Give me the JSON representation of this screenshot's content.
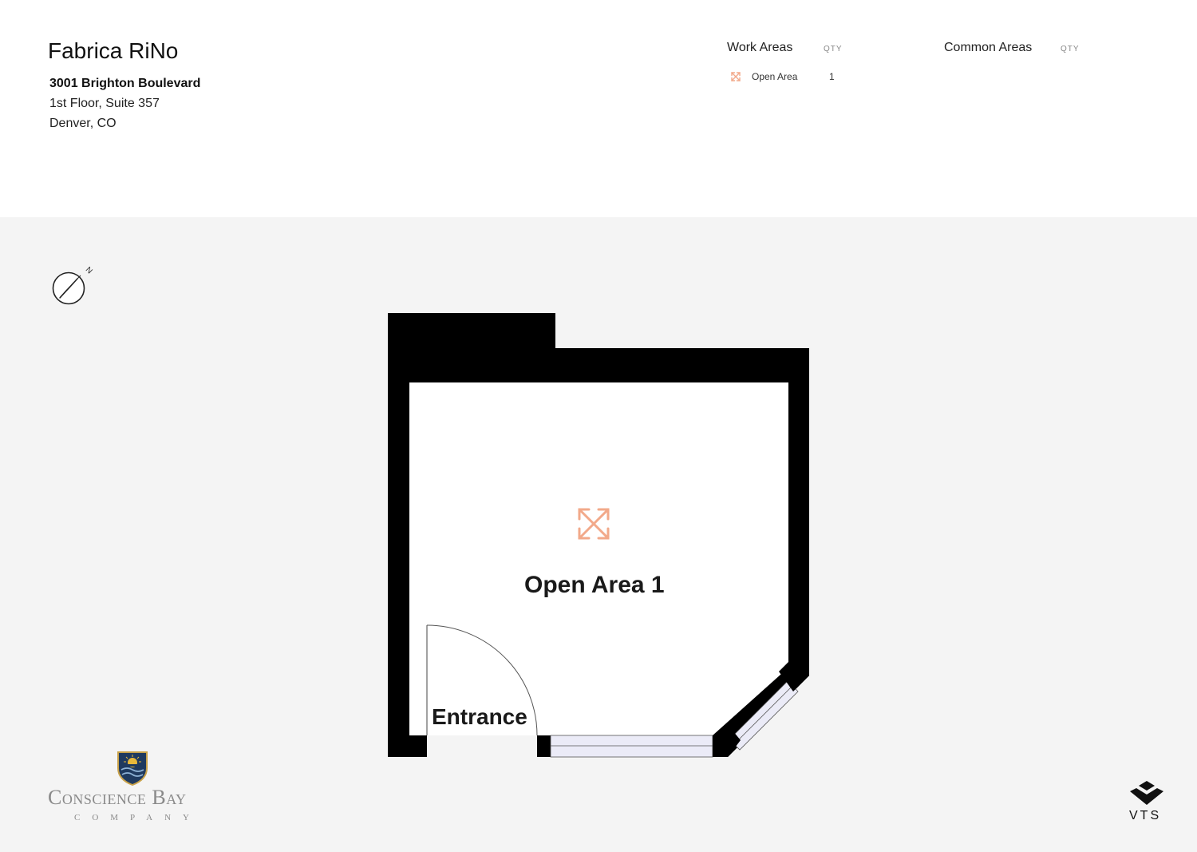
{
  "header": {
    "title": "Fabrica RiNo",
    "address_line1": "3001 Brighton Boulevard",
    "address_line2": "1st Floor, Suite 357",
    "address_line3": "Denver, CO"
  },
  "legend": {
    "work_areas_heading": "Work Areas",
    "work_areas_qty_heading": "QTY",
    "work_areas_items": [
      {
        "label": "Open Area",
        "qty": "1",
        "icon": "expand-arrows-icon"
      }
    ],
    "common_areas_heading": "Common Areas",
    "common_areas_qty_heading": "QTY"
  },
  "floorplan": {
    "room_label": "Open Area 1",
    "entrance_label": "Entrance",
    "room_icon": "expand-arrows-icon",
    "compass_label": "N",
    "colors": {
      "wall": "#000000",
      "floor": "#ffffff",
      "background": "#f4f4f4",
      "window": "#ebebf7",
      "accent": "#f2a98a"
    }
  },
  "branding": {
    "company_name": "Conscience Bay",
    "company_sub": "COMPANY",
    "vts_logo_text": "VTS"
  }
}
